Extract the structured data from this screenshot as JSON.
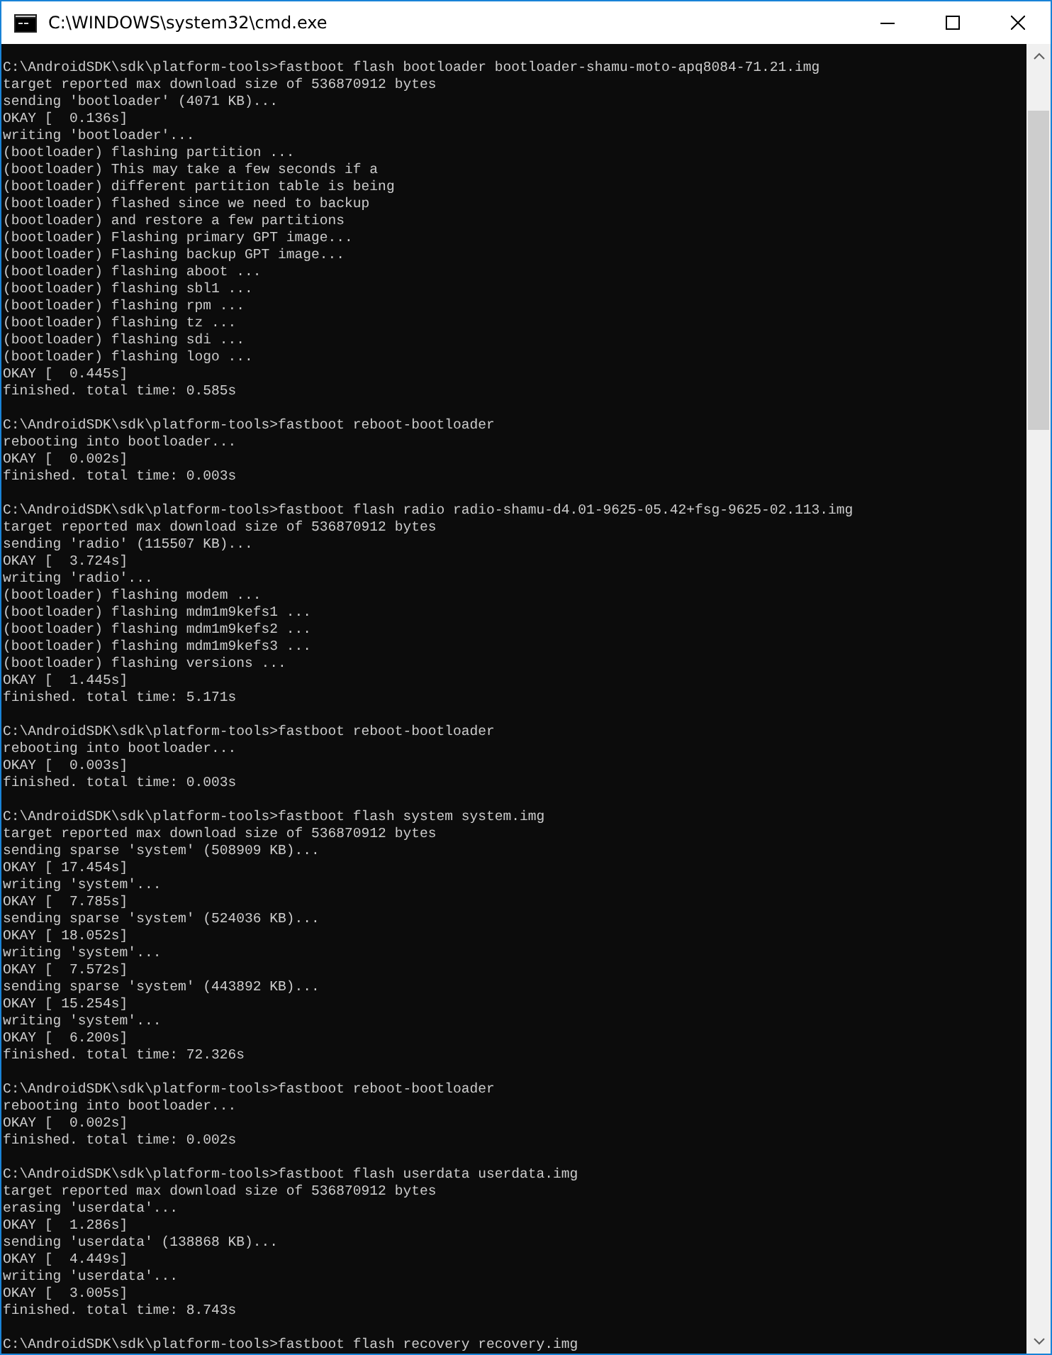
{
  "window": {
    "title": "C:\\WINDOWS\\system32\\cmd.exe"
  },
  "console": {
    "blocks": [
      [
        "C:\\AndroidSDK\\sdk\\platform-tools>fastboot flash bootloader bootloader-shamu-moto-apq8084-71.21.img",
        "target reported max download size of 536870912 bytes",
        "sending 'bootloader' (4071 KB)...",
        "OKAY [  0.136s]",
        "writing 'bootloader'...",
        "(bootloader) flashing partition ...",
        "(bootloader) This may take a few seconds if a",
        "(bootloader) different partition table is being",
        "(bootloader) flashed since we need to backup",
        "(bootloader) and restore a few partitions",
        "(bootloader) Flashing primary GPT image...",
        "(bootloader) Flashing backup GPT image...",
        "(bootloader) flashing aboot ...",
        "(bootloader) flashing sbl1 ...",
        "(bootloader) flashing rpm ...",
        "(bootloader) flashing tz ...",
        "(bootloader) flashing sdi ...",
        "(bootloader) flashing logo ...",
        "OKAY [  0.445s]",
        "finished. total time: 0.585s"
      ],
      [
        "C:\\AndroidSDK\\sdk\\platform-tools>fastboot reboot-bootloader",
        "rebooting into bootloader...",
        "OKAY [  0.002s]",
        "finished. total time: 0.003s"
      ],
      [
        "C:\\AndroidSDK\\sdk\\platform-tools>fastboot flash radio radio-shamu-d4.01-9625-05.42+fsg-9625-02.113.img",
        "target reported max download size of 536870912 bytes",
        "sending 'radio' (115507 KB)...",
        "OKAY [  3.724s]",
        "writing 'radio'...",
        "(bootloader) flashing modem ...",
        "(bootloader) flashing mdm1m9kefs1 ...",
        "(bootloader) flashing mdm1m9kefs2 ...",
        "(bootloader) flashing mdm1m9kefs3 ...",
        "(bootloader) flashing versions ...",
        "OKAY [  1.445s]",
        "finished. total time: 5.171s"
      ],
      [
        "C:\\AndroidSDK\\sdk\\platform-tools>fastboot reboot-bootloader",
        "rebooting into bootloader...",
        "OKAY [  0.003s]",
        "finished. total time: 0.003s"
      ],
      [
        "C:\\AndroidSDK\\sdk\\platform-tools>fastboot flash system system.img",
        "target reported max download size of 536870912 bytes",
        "sending sparse 'system' (508909 KB)...",
        "OKAY [ 17.454s]",
        "writing 'system'...",
        "OKAY [  7.785s]",
        "sending sparse 'system' (524036 KB)...",
        "OKAY [ 18.052s]",
        "writing 'system'...",
        "OKAY [  7.572s]",
        "sending sparse 'system' (443892 KB)...",
        "OKAY [ 15.254s]",
        "writing 'system'...",
        "OKAY [  6.200s]",
        "finished. total time: 72.326s"
      ],
      [
        "C:\\AndroidSDK\\sdk\\platform-tools>fastboot reboot-bootloader",
        "rebooting into bootloader...",
        "OKAY [  0.002s]",
        "finished. total time: 0.002s"
      ],
      [
        "C:\\AndroidSDK\\sdk\\platform-tools>fastboot flash userdata userdata.img",
        "target reported max download size of 536870912 bytes",
        "erasing 'userdata'...",
        "OKAY [  1.286s]",
        "sending 'userdata' (138868 KB)...",
        "OKAY [  4.449s]",
        "writing 'userdata'...",
        "OKAY [  3.005s]",
        "finished. total time: 8.743s"
      ],
      [
        "C:\\AndroidSDK\\sdk\\platform-tools>fastboot flash recovery recovery.img"
      ]
    ]
  }
}
